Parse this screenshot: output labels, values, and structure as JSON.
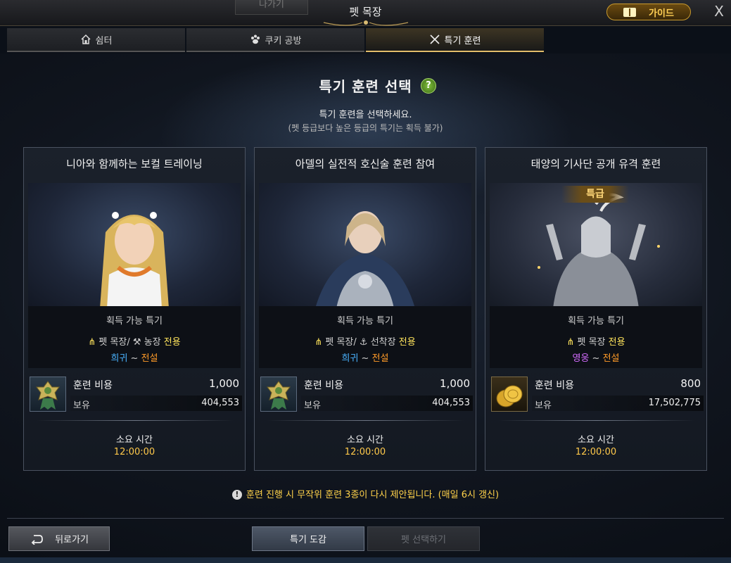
{
  "header": {
    "exit_label": "나가기",
    "title": "펫 목장",
    "guide_label": "가이드",
    "close_label": "X"
  },
  "tabs": [
    {
      "label": "쉼터",
      "icon": "house-icon",
      "active": false
    },
    {
      "label": "쿠키 공방",
      "icon": "paw-icon",
      "active": false
    },
    {
      "label": "특기 훈련",
      "icon": "crossed-swords-icon",
      "active": true
    }
  ],
  "main": {
    "section_title": "특기 훈련 선택",
    "help_label": "?",
    "instruction": "특기 훈련을 선택하세요.",
    "sub_instruction": "(펫 등급보다 높은 등급의 특기는 획득 불가)"
  },
  "cards": [
    {
      "title": "니아와 함께하는 보컬 트레이닝",
      "badge": "",
      "avail_header": "획득 가능 특기",
      "skill_icon": "grass-icon",
      "skill_main": "펫 목장/",
      "skill_place_icon": "farm-tool-icon",
      "skill_place": "농장",
      "skill_suffix": "전용",
      "grade_from": "희귀",
      "grade_sep": "~",
      "grade_to": "전설",
      "grade_from_color": "#4ab3ff",
      "cost_icon": "training-medal-icon",
      "cost_label": "훈련 비용",
      "cost_value": "1,000",
      "own_label": "보유",
      "own_value": "404,553",
      "time_label": "소요 시간",
      "time_value": "12:00:00"
    },
    {
      "title": "아델의 실전적 호신술 훈련 참여",
      "badge": "",
      "avail_header": "획득 가능 특기",
      "skill_icon": "grass-icon",
      "skill_main": "펫 목장/",
      "skill_place_icon": "anchor-icon",
      "skill_place": "선착장",
      "skill_suffix": "전용",
      "grade_from": "희귀",
      "grade_sep": "~",
      "grade_to": "전설",
      "grade_from_color": "#4ab3ff",
      "cost_icon": "training-medal-icon",
      "cost_label": "훈련 비용",
      "cost_value": "1,000",
      "own_label": "보유",
      "own_value": "404,553",
      "time_label": "소요 시간",
      "time_value": "12:00:00"
    },
    {
      "title": "태양의 기사단 공개 유격 훈련",
      "badge": "특급",
      "avail_header": "획득 가능 특기",
      "skill_icon": "grass-icon",
      "skill_main": "펫 목장",
      "skill_place_icon": "",
      "skill_place": "",
      "skill_suffix": "전용",
      "grade_from": "영웅",
      "grade_sep": "~",
      "grade_to": "전설",
      "grade_from_color": "#d46cff",
      "cost_icon": "gold-coins-icon",
      "cost_label": "훈련 비용",
      "cost_value": "800",
      "own_label": "보유",
      "own_value": "17,502,775",
      "time_label": "소요 시간",
      "time_value": "12:00:00"
    }
  ],
  "notice": {
    "icon": "warning-icon",
    "text": "훈련 진행 시 무작위 훈련 3종이 다시 제안됩니다. (매일 6시 갱신)"
  },
  "footer": {
    "back_label": "뒤로가기",
    "back_icon": "return-arrow-icon",
    "book_label": "특기 도감",
    "select_pet_label": "펫 선택하기"
  },
  "colors": {
    "accent_gold": "#e2bd6a",
    "time_gold": "#ffc94a",
    "notice_yellow": "#ffd24a",
    "grade_rare": "#4ab3ff",
    "grade_heroic": "#d46cff",
    "grade_legendary": "#ff9b28",
    "gold_owned": "#7de27d"
  }
}
